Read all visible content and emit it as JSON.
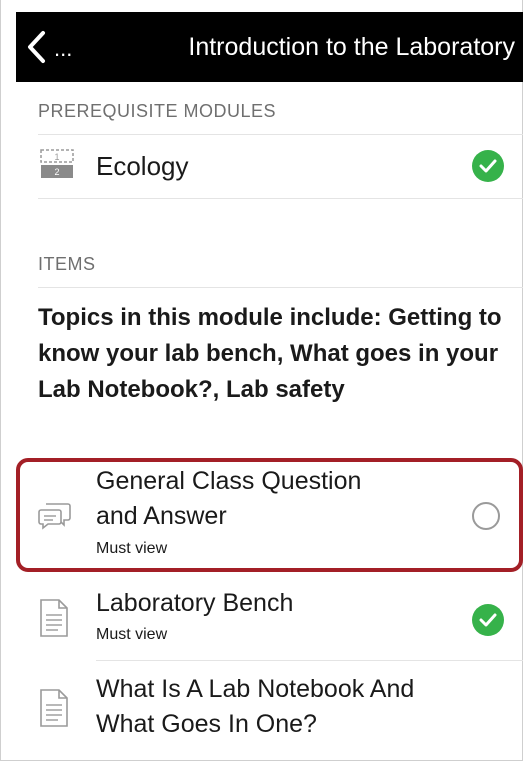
{
  "header": {
    "back_label": "...",
    "title": "Introduction to the Laboratory"
  },
  "prerequisites": {
    "section_title": "PREREQUISITE MODULES",
    "items": [
      {
        "label": "Ecology",
        "status": "completed",
        "icon": "module-icon"
      }
    ]
  },
  "items": {
    "section_title": "ITEMS",
    "description": "Topics in this module include: Getting to know your lab bench, What goes in your Lab Notebook?, Lab safety",
    "list": [
      {
        "title_line1": "General Class Question",
        "title_line2": "and Answer",
        "requirement": "Must view",
        "status": "incomplete",
        "icon": "discussion-icon"
      },
      {
        "title_line1": "Laboratory Bench",
        "requirement": "Must view",
        "status": "completed",
        "icon": "page-icon"
      },
      {
        "title_line1": "What Is A Lab Notebook And",
        "title_line2": "What Goes In One?",
        "status": "none",
        "icon": "page-icon"
      }
    ]
  },
  "colors": {
    "navbar": "#000000",
    "check": "#36b24a",
    "highlight": "#a31f26"
  }
}
